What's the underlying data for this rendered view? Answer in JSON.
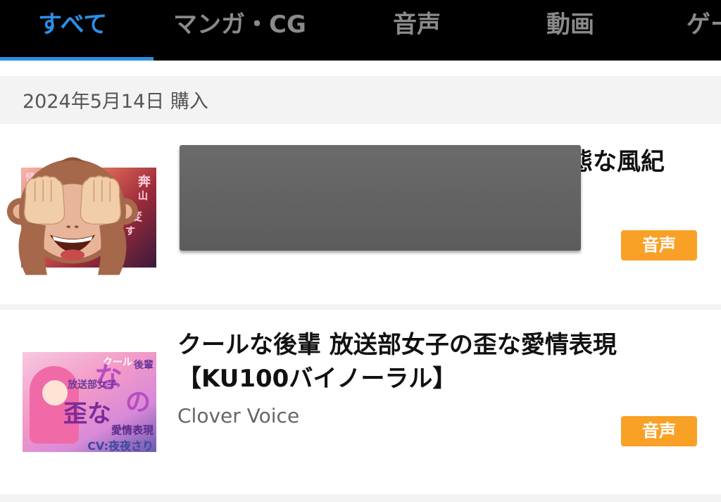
{
  "tabs": [
    {
      "label": "すべて",
      "active": true
    },
    {
      "label": "マンガ・CG",
      "active": false
    },
    {
      "label": "音声",
      "active": false
    },
    {
      "label": "動画",
      "active": false
    },
    {
      "label": "ゲー",
      "active": false
    }
  ],
  "date_header": "2024年5月14日 購入",
  "items": [
    {
      "title_visible_fragment": "態な風紀",
      "category_badge": "音声",
      "thumbnail_cover_text": [
        "怪",
        "奔",
        "山",
        "変",
        "す"
      ],
      "overlay_icon": "see-no-evil-monkey-icon",
      "redacted": true
    },
    {
      "title_lines": [
        "クールな後輩 放送部女子の歪な愛情表現",
        "【KU100バイノーラル】"
      ],
      "author": "Clover Voice",
      "category_badge": "音声",
      "thumbnail_cover_text": [
        "クール",
        "な",
        "後輩",
        "放送部女子",
        "の",
        "歪な",
        "愛情表現",
        "CV:夜夜さり"
      ]
    }
  ],
  "colors": {
    "accent": "#2b8fe6",
    "badge": "#f8a126",
    "tab_bar_bg": "#000000",
    "tab_inactive": "#8a8a8a"
  }
}
